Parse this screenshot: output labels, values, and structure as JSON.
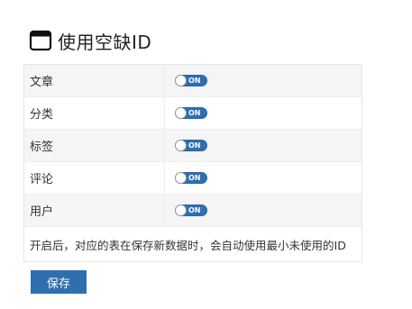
{
  "header": {
    "icon": "window-icon",
    "title": "使用空缺ID"
  },
  "settings": [
    {
      "label": "文章",
      "toggle": "ON"
    },
    {
      "label": "分类",
      "toggle": "ON"
    },
    {
      "label": "标签",
      "toggle": "ON"
    },
    {
      "label": "评论",
      "toggle": "ON"
    },
    {
      "label": "用户",
      "toggle": "ON"
    }
  ],
  "note": "开启后，对应的表在保存新数据时，会自动使用最小未使用的ID",
  "save_label": "保存",
  "colors": {
    "accent": "#2f6fae",
    "toggle_on": "#2d6fb2"
  }
}
